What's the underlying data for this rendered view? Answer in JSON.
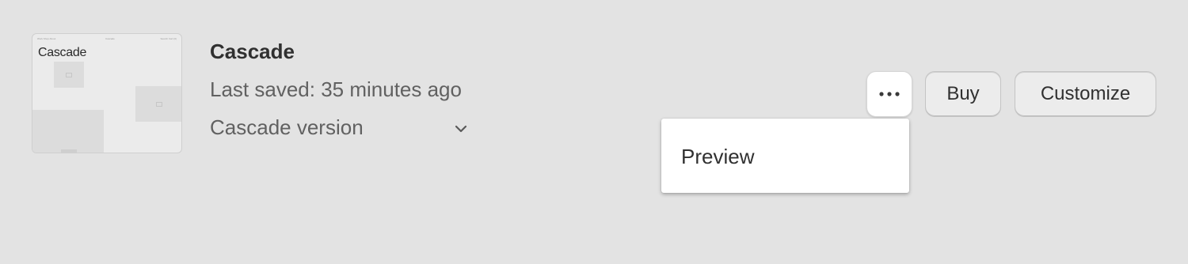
{
  "theme": {
    "name": "Cascade",
    "last_saved": "Last saved: 35 minutes ago",
    "version_label": "Cascade version"
  },
  "thumbnail": {
    "title": "Cascade",
    "nav_left": "Work  Shop  About",
    "nav_center": "Cascade",
    "nav_right": "Search  Cart (0)"
  },
  "actions": {
    "more_icon": "more-horizontal-icon",
    "buy_label": "Buy",
    "customize_label": "Customize"
  },
  "menu": {
    "items": [
      {
        "label": "Preview"
      }
    ]
  },
  "colors": {
    "background": "#e3e3e3",
    "text_primary": "#303030",
    "text_secondary": "#616161",
    "menu_bg": "#ffffff"
  }
}
